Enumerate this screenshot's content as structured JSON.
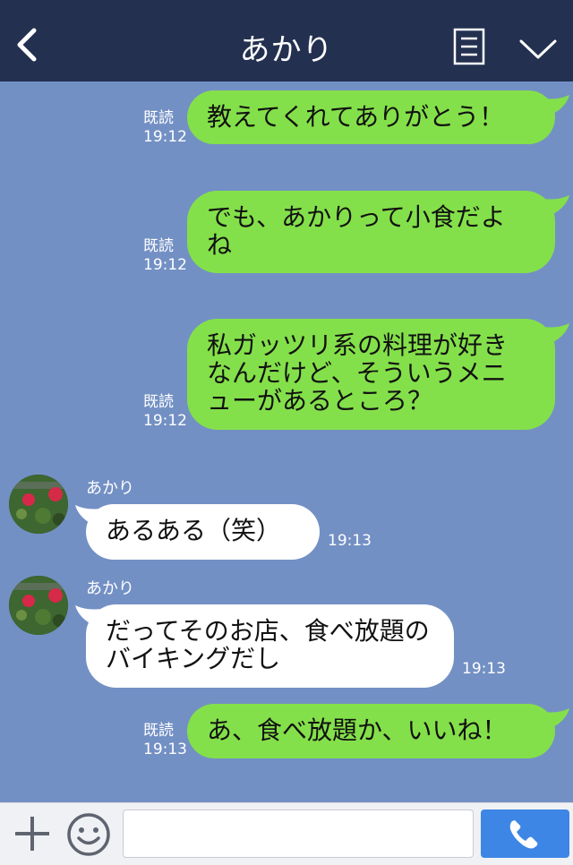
{
  "header": {
    "title": "あかり"
  },
  "messages": [
    {
      "dir": "out",
      "text": "教えてくれてありがとう！",
      "read": "既読",
      "time": "19:12"
    },
    {
      "dir": "out",
      "text": "でも、あかりって小食だよね",
      "read": "既読",
      "time": "19:12"
    },
    {
      "dir": "out",
      "text": "私ガッツリ系の料理が好きなんだけど、そういうメニューがあるところ？",
      "read": "既読",
      "time": "19:12"
    },
    {
      "dir": "in",
      "sender": "あかり",
      "text": "あるある（笑）",
      "time": "19:13"
    },
    {
      "dir": "in",
      "sender": "あかり",
      "text": "だってそのお店、食べ放題のバイキングだし",
      "time": "19:13"
    },
    {
      "dir": "out",
      "text": "あ、食べ放題か、いいね！",
      "read": "既読",
      "time": "19:13"
    }
  ],
  "footer": {
    "input_placeholder": ""
  },
  "colors": {
    "background": "#7390c4",
    "header": "#233050",
    "outgoing_bubble": "#84e04a",
    "incoming_bubble": "#ffffff",
    "call_button": "#3d86e6"
  },
  "icons": [
    "back-chevron-icon",
    "menu-icon",
    "chevron-down-icon",
    "plus-icon",
    "emoji-icon",
    "phone-icon"
  ]
}
